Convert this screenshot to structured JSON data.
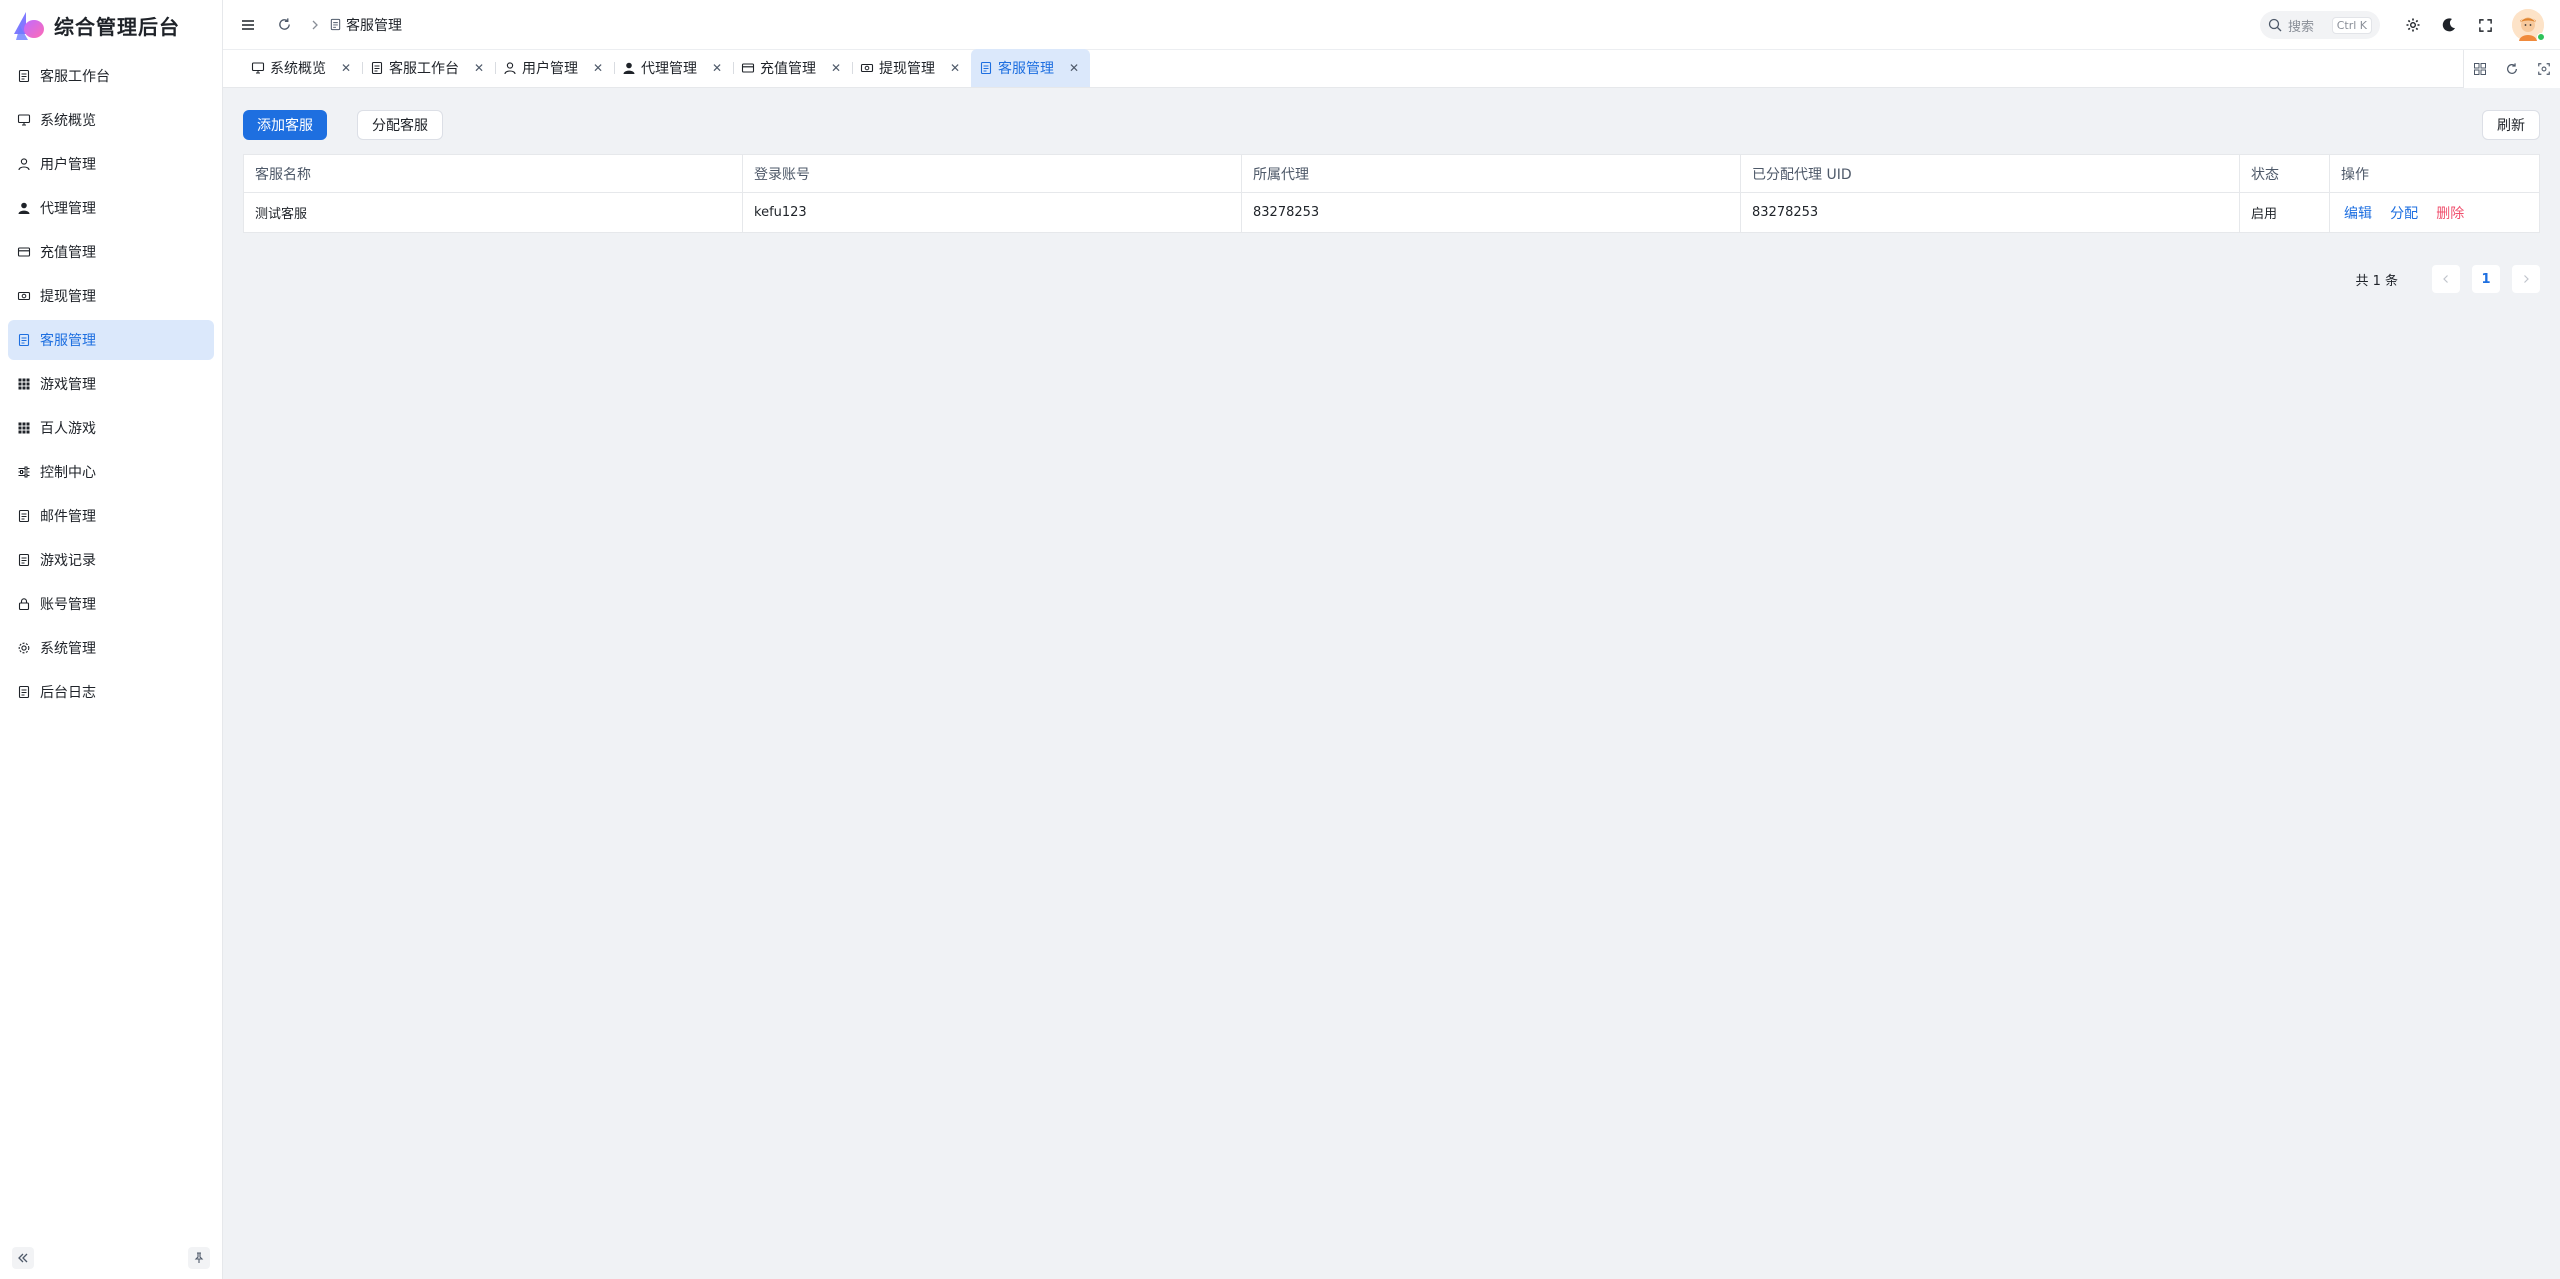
{
  "app": {
    "title": "综合管理后台"
  },
  "colors": {
    "primary": "#1e6fe0",
    "danger": "#f0506e",
    "active_bg": "#dbe8fb"
  },
  "sidebar": {
    "items": [
      {
        "label": "客服工作台",
        "icon": "document-icon"
      },
      {
        "label": "系统概览",
        "icon": "monitor-icon"
      },
      {
        "label": "用户管理",
        "icon": "user-icon"
      },
      {
        "label": "代理管理",
        "icon": "user-filled-icon"
      },
      {
        "label": "充值管理",
        "icon": "card-icon"
      },
      {
        "label": "提现管理",
        "icon": "money-icon"
      },
      {
        "label": "客服管理",
        "icon": "document-icon",
        "active": true
      },
      {
        "label": "游戏管理",
        "icon": "grid-icon"
      },
      {
        "label": "百人游戏",
        "icon": "grid-icon"
      },
      {
        "label": "控制中心",
        "icon": "sliders-icon"
      },
      {
        "label": "邮件管理",
        "icon": "document-icon"
      },
      {
        "label": "游戏记录",
        "icon": "document-icon"
      },
      {
        "label": "账号管理",
        "icon": "lock-icon"
      },
      {
        "label": "系统管理",
        "icon": "gear-icon"
      },
      {
        "label": "后台日志",
        "icon": "document-icon"
      }
    ]
  },
  "header": {
    "breadcrumb": "客服管理",
    "search": {
      "placeholder": "搜索",
      "shortcut": "Ctrl K"
    }
  },
  "tabs": [
    {
      "label": "系统概览",
      "icon": "monitor-icon"
    },
    {
      "label": "客服工作台",
      "icon": "document-icon"
    },
    {
      "label": "用户管理",
      "icon": "user-icon"
    },
    {
      "label": "代理管理",
      "icon": "user-filled-icon"
    },
    {
      "label": "充值管理",
      "icon": "card-icon"
    },
    {
      "label": "提现管理",
      "icon": "money-icon"
    },
    {
      "label": "客服管理",
      "icon": "document-icon",
      "active": true
    }
  ],
  "toolbar": {
    "add_label": "添加客服",
    "assign_label": "分配客服",
    "refresh_label": "刷新"
  },
  "table": {
    "columns": [
      "客服名称",
      "登录账号",
      "所属代理",
      "已分配代理 UID",
      "状态",
      "操作"
    ],
    "rows": [
      {
        "name": "测试客服",
        "account": "kefu123",
        "agent": "83278253",
        "assigned_uid": "83278253",
        "status": "启用",
        "actions": {
          "edit": "编辑",
          "assign": "分配",
          "delete": "删除"
        }
      }
    ]
  },
  "pagination": {
    "total_text": "共 1 条",
    "current_page": "1"
  }
}
